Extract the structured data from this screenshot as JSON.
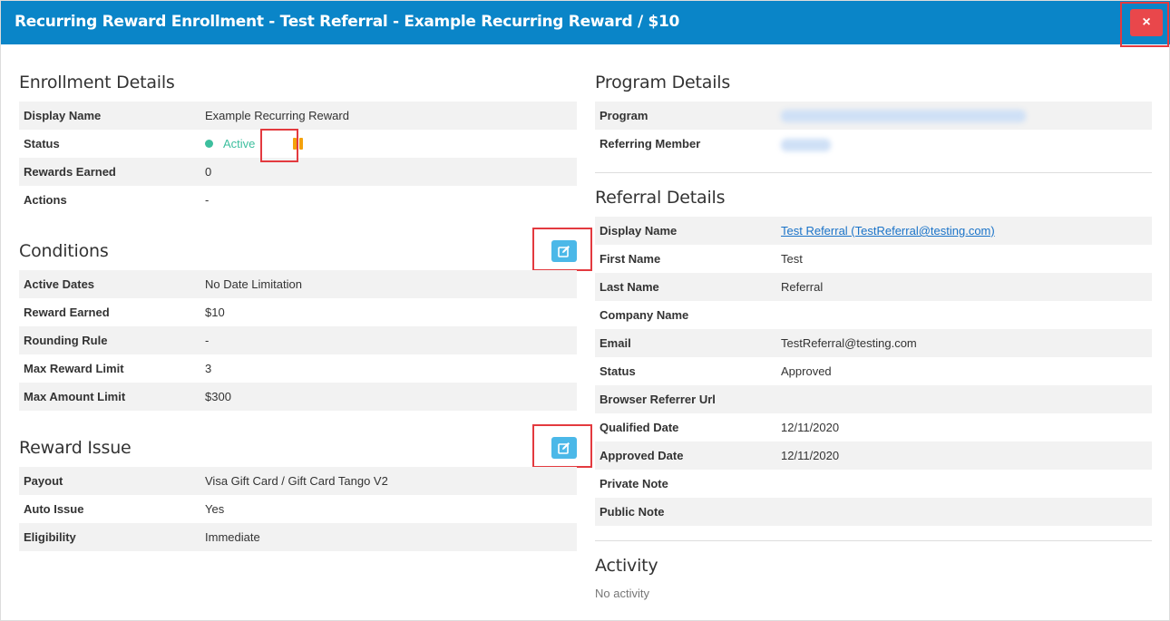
{
  "header": {
    "title": "Recurring Reward Enrollment - Test Referral - Example Recurring Reward / $10",
    "close_label": "×"
  },
  "enrollment_details": {
    "title": "Enrollment Details",
    "rows": [
      {
        "label": "Display Name",
        "value": "Example Recurring Reward"
      },
      {
        "label": "Status",
        "value": "Active"
      },
      {
        "label": "Rewards Earned",
        "value": "0"
      },
      {
        "label": "Actions",
        "value": "-"
      }
    ]
  },
  "conditions": {
    "title": "Conditions",
    "rows": [
      {
        "label": "Active Dates",
        "value": "No Date Limitation"
      },
      {
        "label": "Reward Earned",
        "value": "$10"
      },
      {
        "label": "Rounding Rule",
        "value": "-"
      },
      {
        "label": "Max Reward Limit",
        "value": "3"
      },
      {
        "label": "Max Amount Limit",
        "value": "$300"
      }
    ]
  },
  "reward_issue": {
    "title": "Reward Issue",
    "rows": [
      {
        "label": "Payout",
        "value": "Visa Gift Card / Gift Card Tango V2"
      },
      {
        "label": "Auto Issue",
        "value": "Yes"
      },
      {
        "label": "Eligibility",
        "value": "Immediate"
      }
    ]
  },
  "program_details": {
    "title": "Program Details",
    "rows": [
      {
        "label": "Program",
        "value": ""
      },
      {
        "label": "Referring Member",
        "value": ""
      }
    ]
  },
  "referral_details": {
    "title": "Referral Details",
    "rows": [
      {
        "label": "Display Name",
        "value": "Test Referral (TestReferral@testing.com)"
      },
      {
        "label": "First Name",
        "value": "Test"
      },
      {
        "label": "Last Name",
        "value": "Referral"
      },
      {
        "label": "Company Name",
        "value": ""
      },
      {
        "label": "Email",
        "value": "TestReferral@testing.com"
      },
      {
        "label": "Status",
        "value": "Approved"
      },
      {
        "label": "Browser Referrer Url",
        "value": ""
      },
      {
        "label": "Qualified Date",
        "value": "12/11/2020"
      },
      {
        "label": "Approved Date",
        "value": "12/11/2020"
      },
      {
        "label": "Private Note",
        "value": ""
      },
      {
        "label": "Public Note",
        "value": ""
      }
    ]
  },
  "activity": {
    "title": "Activity",
    "empty_text": "No activity"
  },
  "colors": {
    "header_bg": "#0a85c8",
    "close_bg": "#e9474b",
    "status_active": "#3dbf9e",
    "pause_icon": "#f4a20c",
    "edit_button": "#4bb8e8",
    "highlight": "#e33a3f",
    "link": "#1a73c8"
  }
}
